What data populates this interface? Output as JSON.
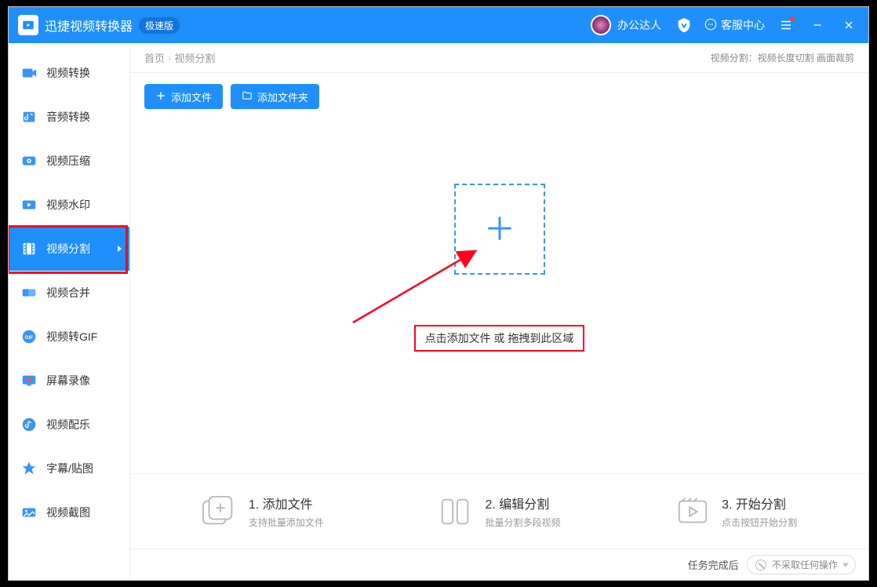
{
  "titlebar": {
    "app_title": "迅捷视频转换器",
    "edition": "极速版",
    "username": "办公达人",
    "support_label": "客服中心"
  },
  "sidebar": {
    "items": [
      {
        "label": "视频转换",
        "icon": "video-convert-icon"
      },
      {
        "label": "音频转换",
        "icon": "audio-convert-icon"
      },
      {
        "label": "视频压缩",
        "icon": "video-compress-icon"
      },
      {
        "label": "视频水印",
        "icon": "video-watermark-icon"
      },
      {
        "label": "视频分割",
        "icon": "video-split-icon",
        "active": true
      },
      {
        "label": "视频合并",
        "icon": "video-merge-icon"
      },
      {
        "label": "视频转GIF",
        "icon": "video-to-gif-icon"
      },
      {
        "label": "屏幕录像",
        "icon": "screen-record-icon"
      },
      {
        "label": "视频配乐",
        "icon": "video-music-icon"
      },
      {
        "label": "字幕/贴图",
        "icon": "subtitle-sticker-icon"
      },
      {
        "label": "视频截图",
        "icon": "video-screenshot-icon"
      }
    ]
  },
  "breadcrumb": {
    "root": "首页",
    "current": "视频分割",
    "right_info": "视频分割：视频长度切割 画面裁剪"
  },
  "toolbar": {
    "add_file_label": "添加文件",
    "add_folder_label": "添加文件夹"
  },
  "drop": {
    "hint": "点击添加文件 或 拖拽到此区域"
  },
  "steps": [
    {
      "title": "1. 添加文件",
      "sub": "支持批量添加文件"
    },
    {
      "title": "2. 编辑分割",
      "sub": "批量分割多段视频"
    },
    {
      "title": "3. 开始分割",
      "sub": "点击按钮开始分割"
    }
  ],
  "footer": {
    "task_done_label": "任务完成后",
    "action_selected": "不采取任何操作"
  }
}
